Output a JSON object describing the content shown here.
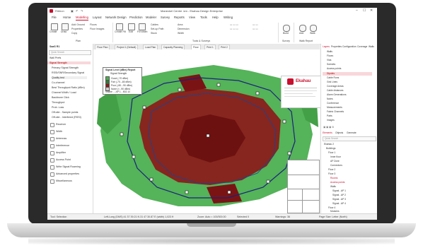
{
  "window": {
    "app_label": "Ribbon",
    "title": "Maneckel Centre .km - Ekahau Design Enterprise",
    "controls": [
      "–",
      "☐",
      "✕"
    ]
  },
  "menu": {
    "items": [
      "File",
      "Home",
      "Modelling",
      "Layout",
      "Network Design",
      "Prediction",
      "Modeler",
      "Survey",
      "Reports",
      "View",
      "Tools",
      "Help",
      "Writing"
    ],
    "active_index": 2
  },
  "ribbon": {
    "groups": [
      {
        "label": "Plan",
        "buttons": [
          "Create",
          "Draw",
          "Add Ground",
          "Properties",
          "Copy",
          "Floors",
          "Floor Images"
        ]
      },
      {
        "label": "Tools & Surveys",
        "buttons": [
          "Create Fill",
          "Edit",
          "Fill Width",
          "Cables",
          "Set-up Path",
          "Stock",
          "Area",
          "Dimension",
          "Width"
        ]
      },
      {
        "label": "Survey",
        "buttons": [
          "Build"
        ]
      },
      {
        "label": "Walk Report",
        "buttons": [
          "Add",
          "Walk"
        ]
      }
    ]
  },
  "left_panel": {
    "header": "SaaS R1",
    "search_placeholder": "Quick Search",
    "items": [
      "Wall Prefs",
      "Signal Strength",
      "Primary Signal Strength",
      "RSSI/SNR/Secondary Signal",
      "Quality test",
      "Co-channel",
      "Best Throughput Ratio (dBm)",
      "Channel Width / Load",
      "Backbone Click",
      "Throughput",
      "Prob. Loss",
      "Off-site - Sample points",
      "Off-site - Interfered (RSSI)",
      "Receiver",
      "Width",
      "Antennas",
      "Interference",
      "Amplifier",
      "Access Point",
      "Write Signal Roaming",
      "Advanced properties",
      "Miscellaneous"
    ],
    "selected_index": 1
  },
  "tabs": [
    "Floor Plan",
    "Project 1 (Default)",
    "Load Plan",
    "Capacity Planning",
    "Floor",
    "Print 1",
    "Print 2"
  ],
  "legend": {
    "title": "Signal Level (dBm) Report",
    "subtitle": "Signal Strength",
    "rows": [
      {
        "label": "Good (-70 dBm)",
        "color": "#4caf50"
      },
      {
        "label": "Fair (-70..-80 dBm)",
        "color": "#2e7d32"
      },
      {
        "label": "Poor (-80..-90 dBm)",
        "color": "#8b1a1a"
      },
      {
        "label": "None (< -90 dBm)",
        "color": "#cccccc"
      }
    ],
    "footer": "Visible ... AP 1 - 802.1x"
  },
  "brand": {
    "name": "Ekahau",
    "color": "#c8102e"
  },
  "colors": {
    "coverage_good": "#4caf50",
    "coverage_poor": "#8b1a1a",
    "accent": "#c8102e"
  },
  "right_panel": {
    "tabs": [
      "Layers",
      "Properties",
      "Configuration",
      "Coverage",
      "Walls"
    ],
    "layers": [
      "Walls",
      "Floors",
      "Vias",
      "Subnets",
      "Access points",
      "Dipoles",
      "Cable Runs",
      "Grid Lines",
      "Coverage Areas",
      "Cable distances",
      "Alarm Generations",
      "Notes",
      "Conference",
      "Measurements",
      "Fabric Channels",
      "Parts",
      "Images"
    ],
    "selected_index": 5,
    "lower_tabs": [
      "Elements",
      "Objects",
      "Generate"
    ],
    "search_placeholder": "Quick Search",
    "tree": [
      "Ekahau 2",
      "Buildings",
      "Floor 1",
      "Inner floor",
      "AP Zone",
      "Connectors",
      "Floor 2",
      "Floor 3",
      "Rooms",
      "Access points",
      "Walls",
      "Signal - AP 1",
      "Signal - AP 2",
      "Signal - AP 3",
      "Signal - AP 4",
      "Floor 4",
      "Modules"
    ]
  },
  "status": {
    "left": "Tool: Selection",
    "center": "Left-Long (DMS) 41 37 39.21 N 31 47 30.87 E (width) 1,023 ft",
    "zoom": "Zoom: Auto = 100/300.00",
    "objects": "Selected 0",
    "warnings": "Warnings: 36",
    "page": "Page Size: Letter (North)"
  }
}
